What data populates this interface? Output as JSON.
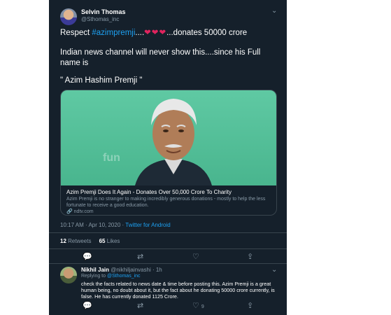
{
  "tweet": {
    "author_name": "Selvin Thomas",
    "author_handle": "@Sthomas_inc",
    "line1_prefix": "Respect ",
    "line1_hashtag": "#azimpremji",
    "line1_dots": "....",
    "line1_hearts": "❤❤❤",
    "line1_suffix": "...donates 50000 crore",
    "line2": "Indian news channel will never show this....since his Full",
    "line3": "name is",
    "line4": "\" Azim Hashim Premji \"",
    "card": {
      "title": "Azim Premji Does It Again - Donates Over 50,000 Crore To Charity",
      "description": "Azim Premji is no stranger to making incredibly generous donations - mostly to help the less fortunate to receive a good education.",
      "domain": "🔗 ndtv.com"
    },
    "timestamp": "10:17 AM · Apr 10, 2020 · ",
    "source": "Twitter for Android",
    "retweets_count": "12",
    "retweets_label": " Retweets",
    "likes_count": "65",
    "likes_label": " Likes"
  },
  "icons": {
    "chevron": "⌄",
    "reply": "💬",
    "retweet": "⇄",
    "like": "♡",
    "share": "⇪"
  },
  "reply": {
    "author_name": "Nikhil Jain",
    "author_handle": " @nikhiljainvashi · 1h",
    "replying_prefix": "Replying to ",
    "replying_handle": "@Sthomas_inc",
    "text": "check the facts related to news date & time before posting this. Azim Premji is a great human being, no doubt about it, but the fact about he donating 50000 crore currently, is false. He has currently donated 1125 Crore.",
    "like_count": "9"
  },
  "colors": {
    "background": "#15202b",
    "accent": "#1da1f2",
    "heart": "#e0245e",
    "muted": "#8899a6",
    "border": "#38444d"
  }
}
